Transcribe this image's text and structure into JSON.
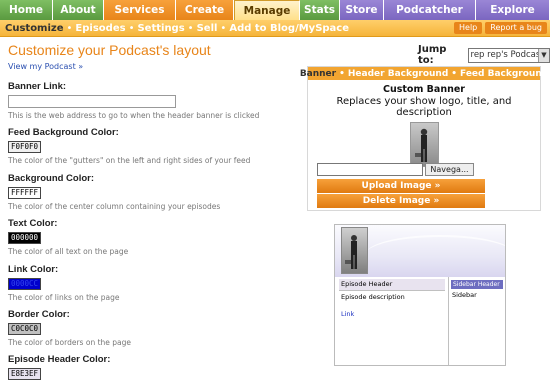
{
  "nav": {
    "tabs": [
      {
        "label": "Home"
      },
      {
        "label": "About"
      },
      {
        "label": "Services"
      },
      {
        "label": "Create"
      },
      {
        "label": "Manage"
      },
      {
        "label": "Stats"
      },
      {
        "label": "Store"
      },
      {
        "label": "Podcatcher"
      },
      {
        "label": "Explore"
      }
    ],
    "active_tab": "Manage"
  },
  "subnav": {
    "items": [
      "Customize",
      "Episodes",
      "Settings",
      "Sell",
      "Add to Blog/MySpace"
    ],
    "help": "Help",
    "report": "Report a bug"
  },
  "page": {
    "title": "Customize your Podcast's layout",
    "view_link": "View my Podcast »",
    "jump_label": "Jump to:",
    "jump_value": "rep rep's Podcast"
  },
  "fields": {
    "banner_link": {
      "label": "Banner Link:",
      "help": "This is the web address to go to when the header banner is clicked"
    },
    "feed_bg": {
      "label": "Feed Background Color:",
      "value": "F0F0F0",
      "help": "The color of the \"gutters\" on the left and right sides of your feed"
    },
    "bg": {
      "label": "Background Color:",
      "value": "FFFFFF",
      "help": "The color of the center column containing your episodes"
    },
    "text": {
      "label": "Text Color:",
      "value": "000000",
      "help": "The color of all text on the page"
    },
    "link": {
      "label": "Link Color:",
      "value": "0000CC",
      "help": "The color of links on the page"
    },
    "border": {
      "label": "Border Color:",
      "value": "C0C0C0",
      "help": "The color of borders on the page"
    },
    "episode_header": {
      "label": "Episode Header Color:",
      "value": "E8E3EF"
    }
  },
  "panel": {
    "tabs": [
      "Banner",
      "Header Background",
      "Feed Background"
    ],
    "title": "Custom Banner",
    "description": "Replaces your show logo, title, and description",
    "browse_label": "Navega...",
    "upload_label": "Upload Image »",
    "delete_label": "Delete Image »"
  },
  "preview": {
    "episode_header": "Episode Header",
    "episode_description": "Episode description",
    "link": "Link",
    "sidebar_header": "Sidebar Header",
    "sidebar": "Sidebar"
  },
  "colors": {
    "accent": "#e8851a",
    "nav_green": "#6aa84f",
    "nav_purple": "#8a74cc"
  }
}
